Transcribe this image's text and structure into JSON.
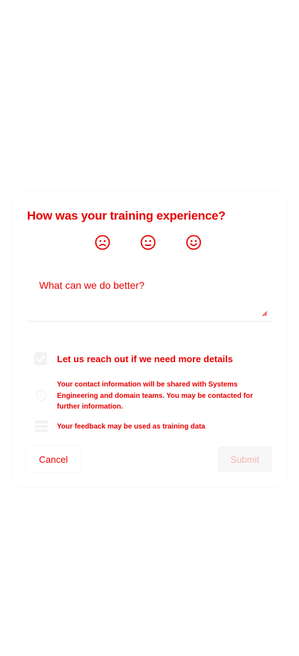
{
  "feedback": {
    "title": "How was your training experience?",
    "ratings": [
      {
        "name": "sad-face-icon",
        "label": "Negative"
      },
      {
        "name": "neutral-face-icon",
        "label": "Neutral"
      },
      {
        "name": "happy-face-icon",
        "label": "Positive"
      }
    ],
    "textarea_placeholder": "What can we do better?",
    "contact_checkbox_label": "Let us reach out if we need more details",
    "contact_checked": true,
    "privacy_note": "Your contact information will be shared with Systems Engineering and domain teams. You may be contacted for further information.",
    "feedback_note": "Your feedback may be used as training data",
    "cancel_label": "Cancel",
    "submit_label": "Submit"
  },
  "colors": {
    "accent": "#e60000",
    "muted": "#f3b5b5",
    "surface": "#ffffff"
  }
}
